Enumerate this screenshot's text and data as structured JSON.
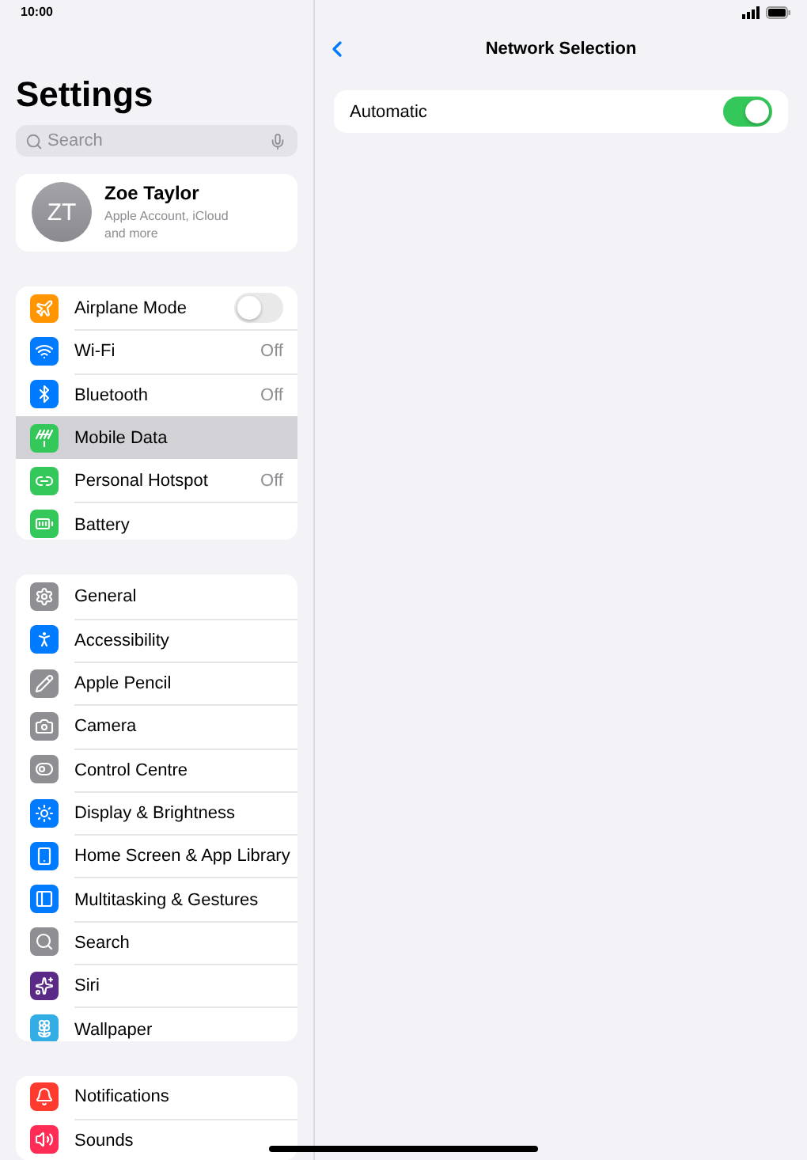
{
  "status_bar": {
    "time": "10:00"
  },
  "sidebar": {
    "title": "Settings",
    "search": {
      "placeholder": "Search"
    },
    "profile": {
      "initials": "ZT",
      "name": "Zoe Taylor",
      "subtitle": "Apple Account, iCloud and more"
    },
    "groups": [
      {
        "items": [
          {
            "label": "Airplane Mode",
            "kind": "toggle",
            "on": false,
            "selected": false
          },
          {
            "label": "Wi-Fi",
            "kind": "value",
            "value": "Off",
            "selected": false
          },
          {
            "label": "Bluetooth",
            "kind": "value",
            "value": "Off",
            "selected": false
          },
          {
            "label": "Mobile Data",
            "kind": "plain",
            "selected": true
          },
          {
            "label": "Personal Hotspot",
            "kind": "value",
            "value": "Off",
            "selected": false
          },
          {
            "label": "Battery",
            "kind": "plain",
            "selected": false
          }
        ]
      },
      {
        "items": [
          {
            "label": "General",
            "kind": "plain",
            "selected": false
          },
          {
            "label": "Accessibility",
            "kind": "plain",
            "selected": false
          },
          {
            "label": "Apple Pencil",
            "kind": "plain",
            "selected": false
          },
          {
            "label": "Camera",
            "kind": "plain",
            "selected": false
          },
          {
            "label": "Control Centre",
            "kind": "plain",
            "selected": false
          },
          {
            "label": "Display & Brightness",
            "kind": "plain",
            "selected": false
          },
          {
            "label": "Home Screen & App Library",
            "kind": "plain",
            "selected": false
          },
          {
            "label": "Multitasking & Gestures",
            "kind": "plain",
            "selected": false
          },
          {
            "label": "Search",
            "kind": "plain",
            "selected": false
          },
          {
            "label": "Siri",
            "kind": "plain",
            "selected": false
          },
          {
            "label": "Wallpaper",
            "kind": "plain",
            "selected": false
          }
        ]
      },
      {
        "items": [
          {
            "label": "Notifications",
            "kind": "plain",
            "selected": false
          },
          {
            "label": "Sounds",
            "kind": "plain",
            "selected": false
          }
        ]
      }
    ]
  },
  "detail": {
    "title": "Network Selection",
    "rows": [
      {
        "label": "Automatic",
        "on": true
      }
    ]
  }
}
